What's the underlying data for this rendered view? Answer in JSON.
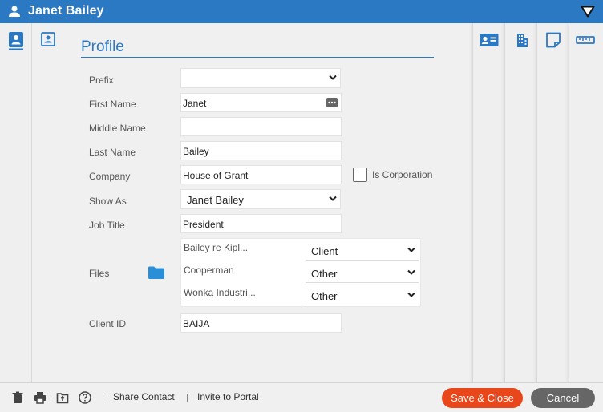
{
  "window": {
    "title": "Janet Bailey"
  },
  "page": {
    "heading": "Profile"
  },
  "form": {
    "prefix": {
      "label": "Prefix",
      "value": ""
    },
    "first_name": {
      "label": "First Name",
      "value": "Janet"
    },
    "middle_name": {
      "label": "Middle Name",
      "value": ""
    },
    "last_name": {
      "label": "Last Name",
      "value": "Bailey"
    },
    "company": {
      "label": "Company",
      "value": "House of Grant"
    },
    "is_corporation": {
      "label": "Is Corporation",
      "checked": false
    },
    "show_as": {
      "label": "Show As",
      "value": "Janet Bailey"
    },
    "job_title": {
      "label": "Job Title",
      "value": "President"
    },
    "files": {
      "label": "Files",
      "items": [
        {
          "name": "Bailey re Kipl...",
          "type": "Client"
        },
        {
          "name": "Cooperman",
          "type": "Other"
        },
        {
          "name": "Wonka Industri...",
          "type": "Other"
        }
      ]
    },
    "client_id": {
      "label": "Client ID",
      "value": "BAIJA"
    }
  },
  "bottom_bar": {
    "share_contact": "Share Contact",
    "invite_to_portal": "Invite to Portal",
    "separator": "|",
    "save_close": "Save & Close",
    "cancel": "Cancel"
  },
  "icons": {
    "title": "user-icon",
    "menu": "triangle-down-icon",
    "left_rail": "contact-book-icon",
    "main": "contact-card-icon",
    "right_panels": [
      "contact-card-icon",
      "building-icon",
      "note-icon",
      "ruler-icon"
    ],
    "bottom": [
      "trash-icon",
      "print-icon",
      "export-icon",
      "help-icon"
    ]
  },
  "colors": {
    "accent": "#2b79c2",
    "save_button": "#e8461b",
    "cancel_button": "#666666"
  }
}
